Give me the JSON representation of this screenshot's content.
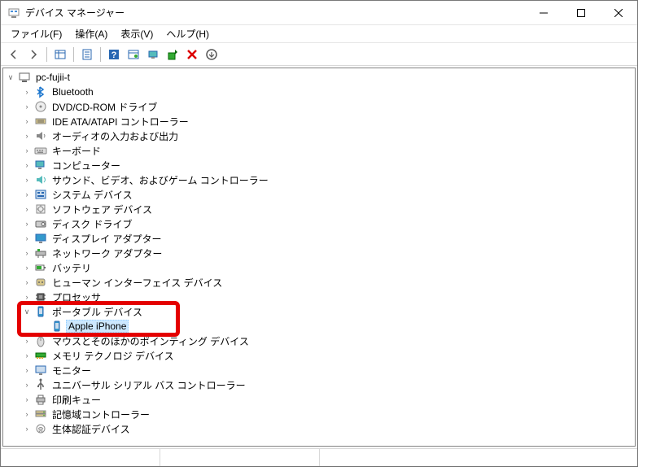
{
  "window": {
    "title": "デバイス マネージャー"
  },
  "menubar": {
    "file": "ファイル(F)",
    "action": "操作(A)",
    "view": "表示(V)",
    "help": "ヘルプ(H)"
  },
  "toolbar": {
    "back": "back",
    "forward": "forward",
    "show_hide": "show-hide",
    "properties": "properties",
    "help": "help",
    "refresh": "refresh",
    "scan": "scan",
    "update": "update",
    "uninstall": "uninstall",
    "enable": "enable"
  },
  "tree": {
    "root": "pc-fujii-t",
    "categories": [
      {
        "label": "Bluetooth",
        "icon": "bluetooth"
      },
      {
        "label": "DVD/CD-ROM ドライブ",
        "icon": "disc"
      },
      {
        "label": "IDE ATA/ATAPI コントローラー",
        "icon": "ide"
      },
      {
        "label": "オーディオの入力および出力",
        "icon": "audio"
      },
      {
        "label": "キーボード",
        "icon": "keyboard"
      },
      {
        "label": "コンピューター",
        "icon": "computer"
      },
      {
        "label": "サウンド、ビデオ、およびゲーム コントローラー",
        "icon": "sound"
      },
      {
        "label": "システム デバイス",
        "icon": "system"
      },
      {
        "label": "ソフトウェア デバイス",
        "icon": "software"
      },
      {
        "label": "ディスク ドライブ",
        "icon": "disk"
      },
      {
        "label": "ディスプレイ アダプター",
        "icon": "display"
      },
      {
        "label": "ネットワーク アダプター",
        "icon": "network"
      },
      {
        "label": "バッテリ",
        "icon": "battery"
      },
      {
        "label": "ヒューマン インターフェイス デバイス",
        "icon": "hid"
      },
      {
        "label": "プロセッサ",
        "icon": "cpu"
      },
      {
        "label": "ポータブル デバイス",
        "icon": "portable",
        "expanded": true,
        "highlighted": true,
        "children": [
          {
            "label": "Apple iPhone",
            "icon": "portable",
            "selected": true
          }
        ]
      },
      {
        "label": "マウスとそのほかのポインティング デバイス",
        "icon": "mouse"
      },
      {
        "label": "メモリ テクノロジ デバイス",
        "icon": "memory"
      },
      {
        "label": "モニター",
        "icon": "monitor"
      },
      {
        "label": "ユニバーサル シリアル バス コントローラー",
        "icon": "usb"
      },
      {
        "label": "印刷キュー",
        "icon": "printer"
      },
      {
        "label": "記憶域コントローラー",
        "icon": "storage"
      },
      {
        "label": "生体認証デバイス",
        "icon": "biometric"
      }
    ]
  }
}
